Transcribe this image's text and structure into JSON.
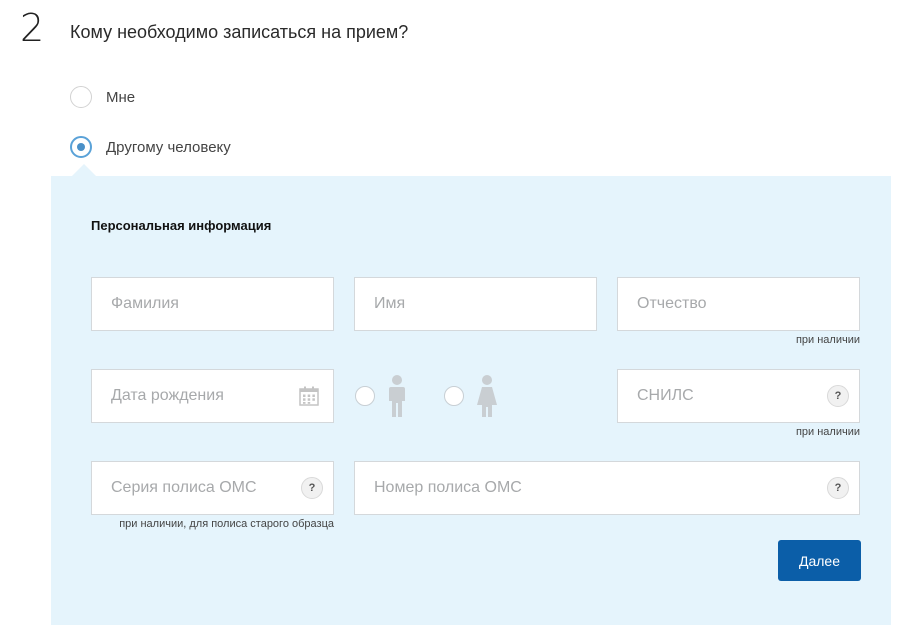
{
  "step": {
    "number": "2",
    "question": "Кому необходимо записаться на прием?"
  },
  "options": {
    "me": {
      "label": "Мне",
      "selected": false
    },
    "other": {
      "label": "Другому человеку",
      "selected": true
    }
  },
  "form": {
    "section_title": "Персональная информация",
    "last_name": {
      "placeholder": "Фамилия",
      "value": ""
    },
    "first_name": {
      "placeholder": "Имя",
      "value": ""
    },
    "patronymic": {
      "placeholder": "Отчество",
      "value": "",
      "hint": "при наличии"
    },
    "birth_date": {
      "placeholder": "Дата рождения",
      "value": ""
    },
    "gender": {
      "options": [
        "male",
        "female"
      ],
      "selected": null
    },
    "snils": {
      "placeholder": "СНИЛС",
      "value": "",
      "hint": "при наличии",
      "help": "?"
    },
    "policy_series": {
      "placeholder": "Серия полиса ОМС",
      "value": "",
      "hint": "при наличии, для полиса старого образца",
      "help": "?"
    },
    "policy_number": {
      "placeholder": "Номер полиса ОМС",
      "value": "",
      "help": "?"
    },
    "next_label": "Далее"
  },
  "colors": {
    "panel_bg": "#e5f4fc",
    "accent": "#4a90c8",
    "button": "#0b5ea8",
    "placeholder": "#a7a9ab"
  }
}
